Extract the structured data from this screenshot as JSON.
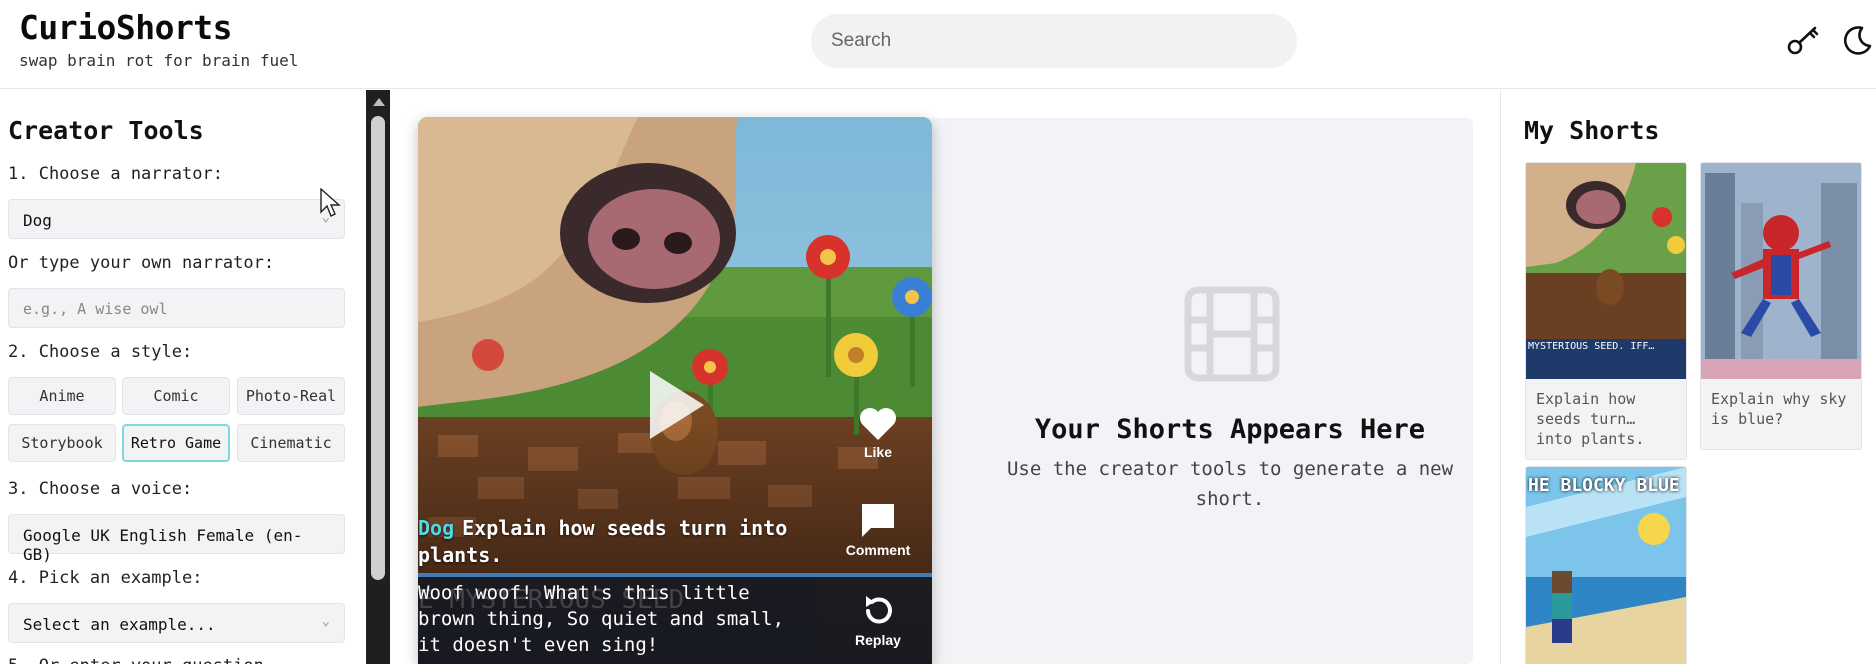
{
  "header": {
    "brand_title": "CurioShorts",
    "brand_tagline": "swap brain rot for brain fuel",
    "search_placeholder": "Search",
    "icons": [
      "key-icon",
      "moon-icon"
    ]
  },
  "sidebar": {
    "title": "Creator Tools",
    "step1_label": "1. Choose a narrator:",
    "narrator_selected": "Dog",
    "custom_narrator_label": "Or type your own narrator:",
    "custom_narrator_placeholder": "e.g., A wise owl",
    "step2_label": "2. Choose a style:",
    "styles": [
      {
        "label": "Anime",
        "active": false
      },
      {
        "label": "Comic",
        "active": false
      },
      {
        "label": "Photo-Real",
        "active": false
      },
      {
        "label": "Storybook",
        "active": false
      },
      {
        "label": "Retro Game",
        "active": true
      },
      {
        "label": "Cinematic",
        "active": false
      }
    ],
    "step3_label": "3. Choose a voice:",
    "voice_selected": "Google UK English Female (en-GB)",
    "step4_label": "4. Pick an example:",
    "example_selected": "Select an example...",
    "step5_label": "5. Or enter your question"
  },
  "video": {
    "narrator": "Dog",
    "question": "Explain how seeds turn into plants.",
    "subtitle": "Woof woof! What's this little brown thing, So quiet and small, it doesn't even sing!",
    "watermark": "E MYSTERIOUS SEED",
    "actions": {
      "like": "Like",
      "comment": "Comment",
      "replay": "Replay"
    }
  },
  "empty_state": {
    "title": "Your Shorts Appears Here",
    "subtitle": "Use the creator tools to generate a new short."
  },
  "my_shorts": {
    "title": "My Shorts",
    "items": [
      {
        "caption": "Explain how seeds turn… into plants.",
        "thumb_text": "MYSTERIOUS SEED. IFF…"
      },
      {
        "caption": "Explain why sky is blue?",
        "thumb_text": ""
      },
      {
        "caption": "",
        "thumb_text": "HE BLOCKY BLUE"
      }
    ]
  },
  "colors": {
    "accent": "#4fd9e6",
    "active_border": "#7dd8e0",
    "panel_bg": "#f2f3f6"
  }
}
